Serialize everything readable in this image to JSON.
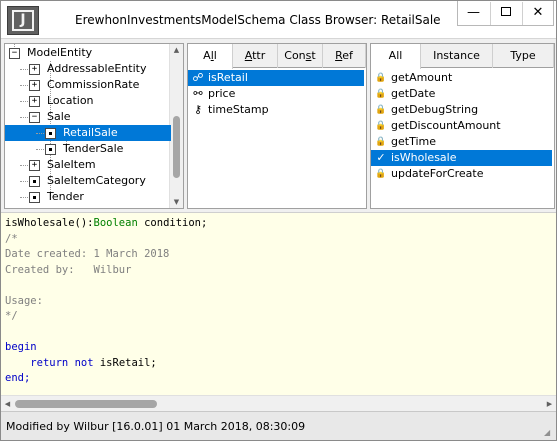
{
  "window": {
    "title": "ErewhonInvestmentsModelSchema Class Browser: RetailSale",
    "icon_letter": "J",
    "controls": {
      "minimize": "—",
      "maximize": "",
      "close": "✕"
    }
  },
  "class_tree": {
    "items": [
      {
        "label": "ModelEntity",
        "expander": "−",
        "selected": false
      },
      {
        "label": "AddressableEntity",
        "expander": "+",
        "selected": false
      },
      {
        "label": "CommissionRate",
        "expander": "+",
        "selected": false
      },
      {
        "label": "Location",
        "expander": "+",
        "selected": false
      },
      {
        "label": "Sale",
        "expander": "−",
        "selected": false
      },
      {
        "label": "RetailSale",
        "expander": "",
        "selected": true
      },
      {
        "label": "TenderSale",
        "expander": "",
        "selected": false
      },
      {
        "label": "SaleItem",
        "expander": "+",
        "selected": false
      },
      {
        "label": "SaleItemCategory",
        "expander": "",
        "selected": false
      },
      {
        "label": "Tender",
        "expander": "",
        "selected": false
      }
    ]
  },
  "properties": {
    "tabs": [
      {
        "pre": "A",
        "u": "l",
        "post": "l",
        "active": true
      },
      {
        "pre": "",
        "u": "A",
        "post": "ttr",
        "active": false
      },
      {
        "pre": "Con",
        "u": "s",
        "post": "t",
        "active": false
      },
      {
        "pre": "",
        "u": "R",
        "post": "ef",
        "active": false
      }
    ],
    "items": [
      {
        "icon": "link-icon",
        "glyph": "☍",
        "label": "isRetail",
        "selected": true
      },
      {
        "icon": "reference-icon",
        "glyph": "⚯",
        "label": "price",
        "selected": false
      },
      {
        "icon": "key-icon",
        "glyph": "⚷",
        "label": "timeStamp",
        "selected": false
      }
    ]
  },
  "methods": {
    "tabs": [
      {
        "label": "All",
        "active": true
      },
      {
        "label": "Instance",
        "active": false
      },
      {
        "label": "Type",
        "active": false
      }
    ],
    "items": [
      {
        "icon": "lock-icon",
        "glyph": "🔒",
        "label": "getAmount",
        "selected": false
      },
      {
        "icon": "lock-icon",
        "glyph": "🔒",
        "label": "getDate",
        "selected": false
      },
      {
        "icon": "lock-icon",
        "glyph": "🔒",
        "label": "getDebugString",
        "selected": false
      },
      {
        "icon": "lock-icon",
        "glyph": "🔒",
        "label": "getDiscountAmount",
        "selected": false
      },
      {
        "icon": "lock-icon",
        "glyph": "🔒",
        "label": "getTime",
        "selected": false
      },
      {
        "icon": "check-icon",
        "glyph": "✓",
        "label": "isWholesale",
        "selected": true
      },
      {
        "icon": "lock-icon",
        "glyph": "🔒",
        "label": "updateForCreate",
        "selected": false
      }
    ]
  },
  "editor": {
    "lines": [
      [
        {
          "t": "isWholesale():",
          "c": "c-default"
        },
        {
          "t": "Boolean",
          "c": "c-type"
        },
        {
          "t": " condition;",
          "c": "c-default"
        }
      ],
      [
        {
          "t": "/*",
          "c": "c-comment"
        }
      ],
      [
        {
          "t": "Date created: 1 March 2018",
          "c": "c-comment"
        }
      ],
      [
        {
          "t": "Created by:   Wilbur",
          "c": "c-comment"
        }
      ],
      [
        {
          "t": "",
          "c": "c-default"
        }
      ],
      [
        {
          "t": "Usage:",
          "c": "c-comment"
        }
      ],
      [
        {
          "t": "*/",
          "c": "c-comment"
        }
      ],
      [
        {
          "t": "",
          "c": "c-default"
        }
      ],
      [
        {
          "t": "begin",
          "c": "c-kw"
        }
      ],
      [
        {
          "t": "    ",
          "c": "c-default"
        },
        {
          "t": "return",
          "c": "c-kw"
        },
        {
          "t": " ",
          "c": "c-default"
        },
        {
          "t": "not",
          "c": "c-kw"
        },
        {
          "t": " isRetail;",
          "c": "c-default"
        }
      ],
      [
        {
          "t": "end;",
          "c": "c-kw"
        }
      ]
    ]
  },
  "status": {
    "text": "Modified by Wilbur [16.0.01] 01 March 2018, 08:30:09"
  },
  "colors": {
    "selection": "#0078d7",
    "editor_bg": "#ffffe8",
    "keyword": "#0000c8",
    "type": "#008000",
    "comment": "#808080"
  }
}
